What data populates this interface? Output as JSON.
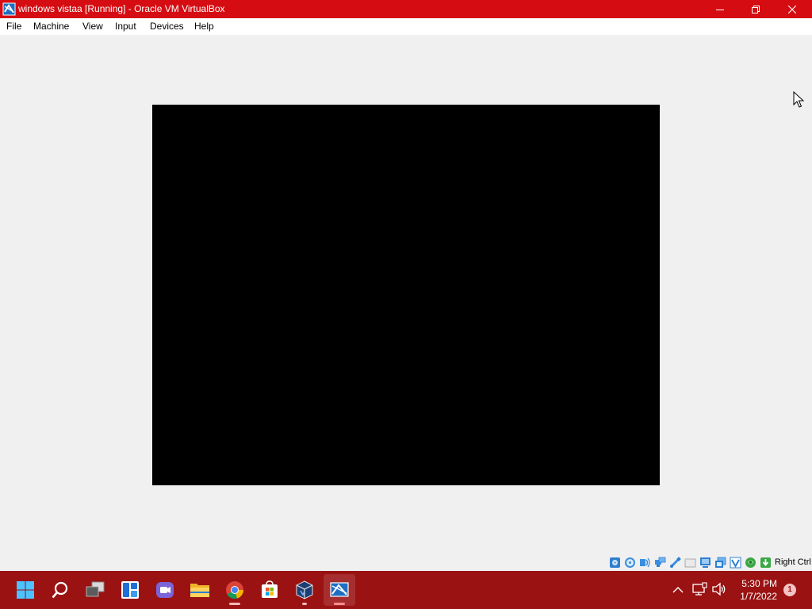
{
  "window": {
    "title": "windows vistaa [Running] - Oracle VM VirtualBox",
    "accent": "#d50c12"
  },
  "menu": {
    "items": [
      "File",
      "Machine",
      "View",
      "Input",
      "Devices",
      "Help"
    ]
  },
  "vm_screen": {
    "background": "#000000"
  },
  "statusbar": {
    "icons": [
      "hard-disk-icon",
      "optical-drive-icon",
      "audio-icon",
      "network-icon",
      "usb-icon",
      "shared-folders-icon",
      "display-icon",
      "recording-icon",
      "virtualization-icon",
      "mouse-integration-icon",
      "host-key-icon"
    ],
    "host_key": "Right Ctrl"
  },
  "taskbar": {
    "background": "#9a1212",
    "apps": [
      "start-icon",
      "search-icon",
      "task-view-icon",
      "widgets-icon",
      "chat-icon",
      "file-explorer-icon",
      "chrome-icon",
      "store-icon",
      "virtualbox-icon",
      "vm-window-icon"
    ],
    "clock_time": "5:30 PM",
    "clock_date": "1/7/2022",
    "notification_count": "1"
  }
}
